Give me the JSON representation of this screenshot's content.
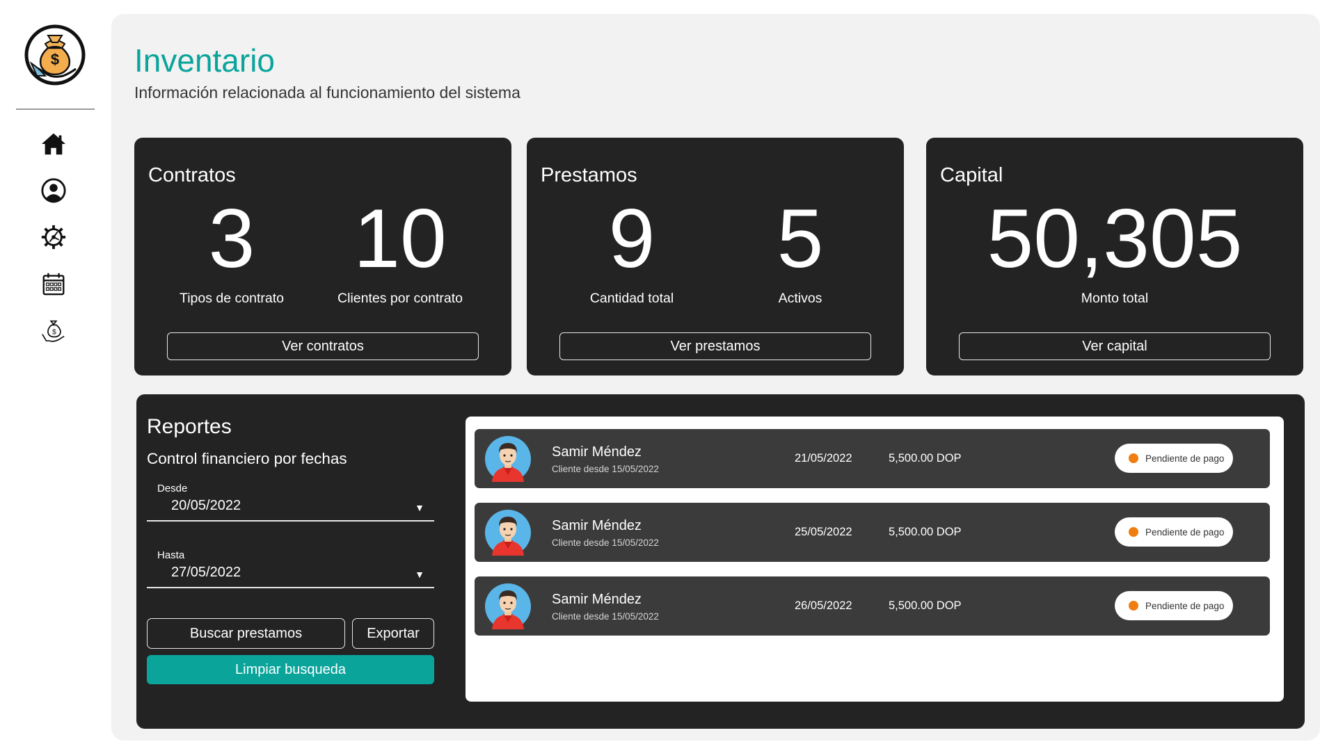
{
  "header": {
    "title": "Inventario",
    "subtitle": "Información relacionada al funcionamiento del sistema"
  },
  "sidebar": {
    "logo_icon": "money-bag-hand-icon",
    "items": [
      {
        "icon": "home-icon"
      },
      {
        "icon": "user-circle-icon"
      },
      {
        "icon": "gear-icon"
      },
      {
        "icon": "calendar-icon"
      },
      {
        "icon": "money-bag-hand-icon"
      }
    ]
  },
  "cards": {
    "contracts": {
      "title": "Contratos",
      "stats": [
        {
          "value": "3",
          "label": "Tipos de contrato"
        },
        {
          "value": "10",
          "label": "Clientes por contrato"
        }
      ],
      "button": "Ver contratos"
    },
    "loans": {
      "title": "Prestamos",
      "stats": [
        {
          "value": "9",
          "label": "Cantidad total"
        },
        {
          "value": "5",
          "label": "Activos"
        }
      ],
      "button": "Ver prestamos"
    },
    "capital": {
      "title": "Capital",
      "stats": [
        {
          "value": "50,305",
          "label": "Monto total"
        }
      ],
      "button": "Ver capital"
    }
  },
  "reports": {
    "title": "Reportes",
    "subtitle": "Control financiero por fechas",
    "from": {
      "label": "Desde",
      "value": "20/05/2022"
    },
    "to": {
      "label": "Hasta",
      "value": "27/05/2022"
    },
    "search_button": "Buscar prestamos",
    "export_button": "Exportar",
    "clear_button": "Limpiar busqueda",
    "rows": [
      {
        "name": "Samir Méndez",
        "since": "Cliente desde 15/05/2022",
        "date": "21/05/2022",
        "amount": "5,500.00 DOP",
        "status": "Pendiente de pago"
      },
      {
        "name": "Samir Méndez",
        "since": "Cliente desde 15/05/2022",
        "date": "25/05/2022",
        "amount": "5,500.00 DOP",
        "status": "Pendiente de pago"
      },
      {
        "name": "Samir Méndez",
        "since": "Cliente desde 15/05/2022",
        "date": "26/05/2022",
        "amount": "5,500.00 DOP",
        "status": "Pendiente de pago"
      }
    ]
  },
  "colors": {
    "accent": "#0aa49b",
    "card_bg": "#232323",
    "row_bg": "#3b3b3b",
    "status_pending": "#f07d10",
    "panel_bg": "#f2f2f2"
  }
}
